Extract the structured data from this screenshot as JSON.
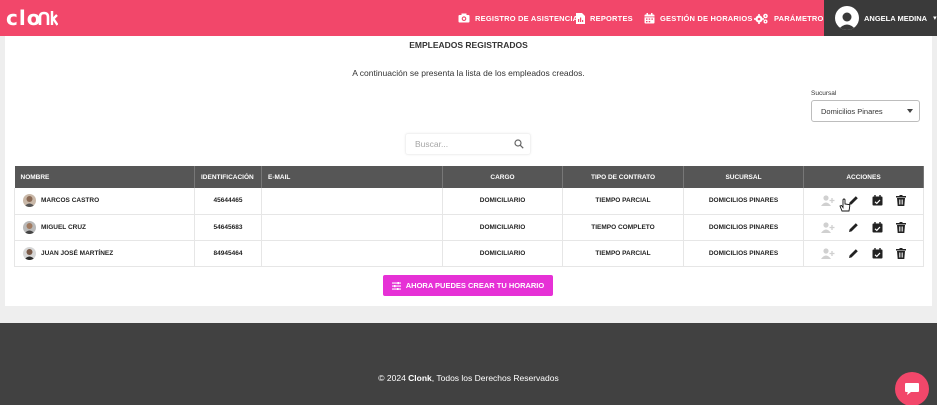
{
  "brand": {
    "logo": "cloпk",
    "accent": "#f2476a",
    "cta_color": "#e631d6"
  },
  "nav": [
    {
      "label": "REGISTRO DE ASISTENCIA",
      "icon": "camera-icon"
    },
    {
      "label": "REPORTES",
      "icon": "document-chart-icon"
    },
    {
      "label": "GESTIÓN DE HORARIOS",
      "icon": "calendar-icon"
    },
    {
      "label": "PARÁMETROS",
      "icon": "gears-icon"
    }
  ],
  "user": {
    "name": "ANGELA MEDINA"
  },
  "page": {
    "title": "EMPLEADOS REGISTRADOS",
    "subtitle": "A continuación se presenta la lista de los empleados creados."
  },
  "sucursal": {
    "label": "Sucursal",
    "selected": "Domicilios Pinares"
  },
  "search": {
    "placeholder": "Buscar..."
  },
  "table": {
    "headers": [
      "NOMBRE",
      "IDENTIFICACIÓN",
      "E-MAIL",
      "CARGO",
      "TIPO DE CONTRATO",
      "SUCURSAL",
      "ACCIONES"
    ],
    "rows": [
      {
        "name": "MARCOS CASTRO",
        "id": "45644465",
        "email": "",
        "cargo": "DOMICILIARIO",
        "contrato": "TIEMPO PARCIAL",
        "sucursal": "DOMICILIOS PINARES"
      },
      {
        "name": "MIGUEL CRUZ",
        "id": "54645683",
        "email": "",
        "cargo": "DOMICILIARIO",
        "contrato": "TIEMPO COMPLETO",
        "sucursal": "DOMICILIOS PINARES"
      },
      {
        "name": "JUAN JOSÉ MARTÍNEZ",
        "id": "84945464",
        "email": "",
        "cargo": "DOMICILIARIO",
        "contrato": "TIEMPO PARCIAL",
        "sucursal": "DOMICILIOS PINARES"
      }
    ],
    "action_icons": [
      "add-user-icon",
      "pencil-icon",
      "calendar-check-icon",
      "trash-icon"
    ]
  },
  "cta": {
    "label": "AHORA PUEDES CREAR TU HORARIO"
  },
  "footer": {
    "prefix": "© 2024 ",
    "brand": "Clonk",
    "suffix": ", Todos los Derechos Reservados"
  }
}
